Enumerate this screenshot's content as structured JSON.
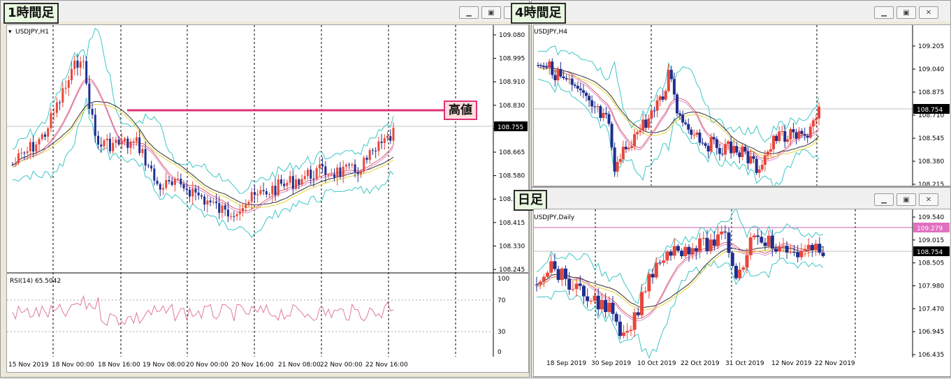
{
  "windows": [
    {
      "id": "h1",
      "label": "1時間足",
      "symbol": "USDJPY,H1",
      "y_ticks": [
        "109.080",
        "108.995",
        "108.910",
        "108.830",
        "108.750",
        "108.665",
        "108.580",
        "108.500",
        "108.415",
        "108.330",
        "108.245"
      ],
      "current_price": "108.755",
      "rsi_label": "RSI(14) 65.5042",
      "rsi_ticks": [
        "100",
        "70",
        "30",
        "0"
      ],
      "x_ticks": [
        "15 Nov 2019",
        "18 Nov 00:00",
        "18 Nov 16:00",
        "19 Nov 08:00",
        "20 Nov 00:00",
        "20 Nov 16:00",
        "21 Nov 08:00",
        "22 Nov 00:00",
        "22 Nov 16:00"
      ],
      "annotation": "高値"
    },
    {
      "id": "h4",
      "label": "4時間足",
      "symbol": "USDJPY,H4",
      "y_ticks": [
        "109.205",
        "109.040",
        "108.875",
        "108.710",
        "108.545",
        "108.380",
        "108.215"
      ],
      "current_price": "108.754",
      "x_ticks": []
    },
    {
      "id": "d1",
      "label": "日足",
      "symbol": "USDJPY,Daily",
      "y_ticks": [
        "109.540",
        "109.015",
        "108.505",
        "107.980",
        "107.470",
        "106.945",
        "106.435"
      ],
      "current_price": "108.754",
      "high_price": "109.279",
      "x_ticks": [
        "18 Sep 2019",
        "30 Sep 2019",
        "10 Oct 2019",
        "22 Oct 2019",
        "31 Oct 2019",
        "12 Nov 2019",
        "22 Nov 2019"
      ]
    }
  ],
  "colors": {
    "bull": "#e8473b",
    "bear": "#1f2f8f",
    "annotation": "#e0327a",
    "band": "#3fc6c6",
    "rsi": "#e07aa0"
  },
  "icons": {
    "minimize": "minimize-icon",
    "restore": "restore-icon",
    "close": "close-icon"
  }
}
